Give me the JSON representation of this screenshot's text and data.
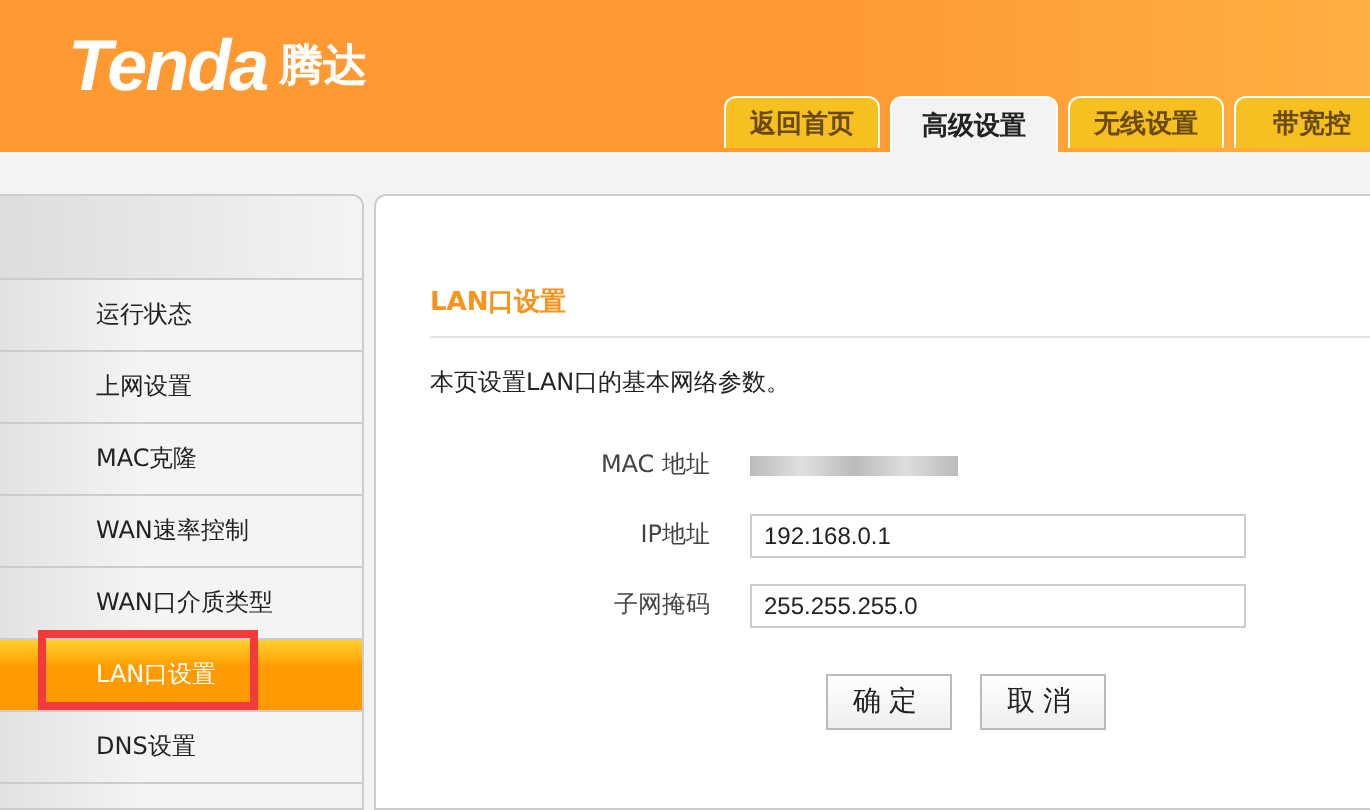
{
  "header": {
    "logo": "Tenda",
    "brand": "腾达"
  },
  "tabs": [
    {
      "label": "返回首页",
      "selected": false
    },
    {
      "label": "高级设置",
      "selected": true
    },
    {
      "label": "无线设置",
      "selected": false
    },
    {
      "label": "带宽控",
      "selected": false
    }
  ],
  "sidebar": {
    "items": [
      {
        "label": "运行状态",
        "selected": false
      },
      {
        "label": "上网设置",
        "selected": false
      },
      {
        "label": "MAC克隆",
        "selected": false
      },
      {
        "label": "WAN速率控制",
        "selected": false
      },
      {
        "label": "WAN口介质类型",
        "selected": false
      },
      {
        "label": "LAN口设置",
        "selected": true,
        "highlighted": true
      },
      {
        "label": "DNS设置",
        "selected": false
      }
    ]
  },
  "panel": {
    "title": "LAN口设置",
    "description": "本页设置LAN口的基本网络参数。",
    "fields": [
      {
        "kind": "redacted",
        "label": "MAC 地址"
      },
      {
        "kind": "input",
        "label": "IP地址",
        "value": "192.168.0.1"
      },
      {
        "kind": "input",
        "label": "子网掩码",
        "value": "255.255.255.0"
      }
    ],
    "buttons": [
      "确定",
      "取消"
    ]
  }
}
